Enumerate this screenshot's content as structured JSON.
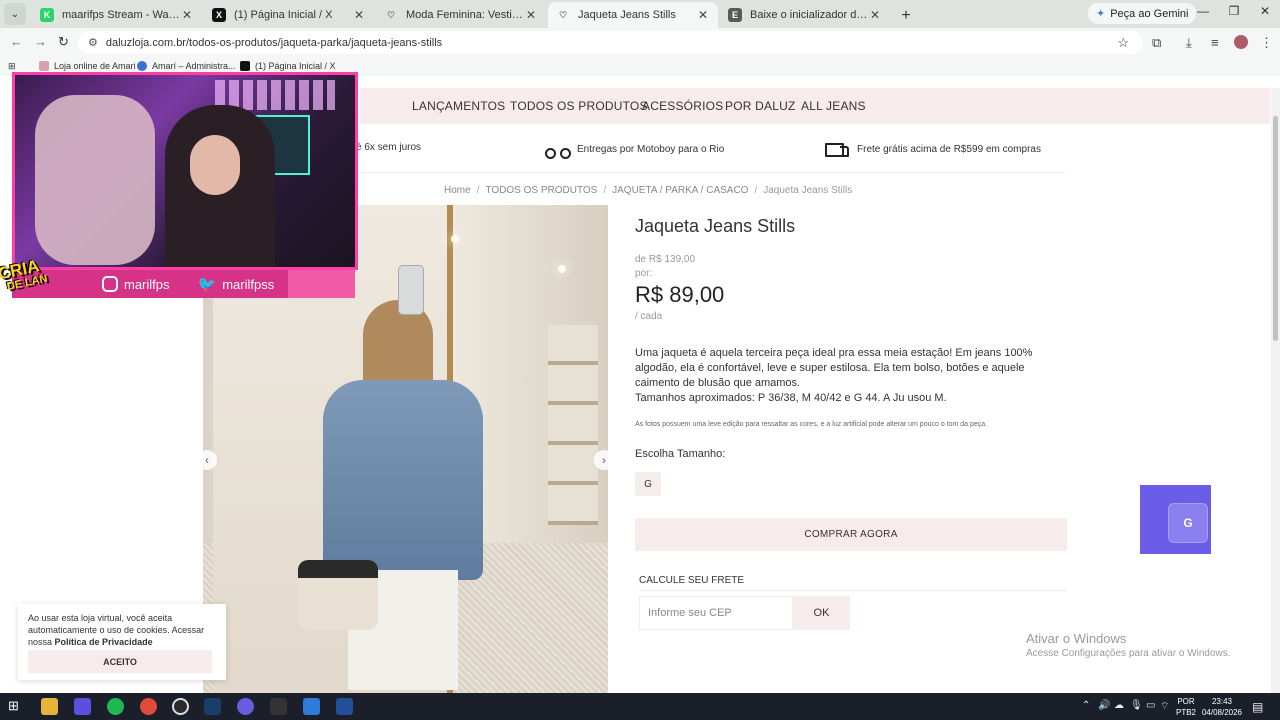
{
  "browser": {
    "tabs": [
      {
        "title": "maarifps Stream - Watch Live o",
        "color": "#2bd46a",
        "letter": "K"
      },
      {
        "title": "(1) Página Inicial / X",
        "color": "#111111",
        "letter": "X"
      },
      {
        "title": "Moda Feminina: Vestidos, Blusa",
        "color": "#c9c9c9",
        "letter": "♡"
      },
      {
        "title": "Jaqueta Jeans Stills",
        "color": "#c9c9c9",
        "letter": "♡"
      },
      {
        "title": "Baixe o inicializador da Epic Ga",
        "color": "#5a5a5a",
        "letter": "E"
      }
    ],
    "gemini_label": "Peça ao Gemini",
    "url": "daluzloja.com.br/todos-os-produtos/jaqueta-parka/jaqueta-jeans-stills",
    "bookmarks": [
      {
        "label": "Loja online de Amari",
        "color": "#d8a0b0"
      },
      {
        "label": "Amarí – Administra...",
        "color": "#3a6fd8"
      },
      {
        "label": "(1) Página Inicial / X",
        "color": "#111111"
      }
    ]
  },
  "site": {
    "nav": [
      "LANÇAMENTOS",
      "TODOS OS PRODUTOS",
      "ACESSÓRIOS",
      "POR DALUZ",
      "ALL JEANS"
    ],
    "benefits": {
      "installments": "é 6x sem juros",
      "motoboy": "Entregas por Motoboy para o Rio",
      "free_shipping": "Frete grátis acima de R$599 em compras"
    },
    "breadcrumb": [
      "Home",
      "TODOS OS PRODUTOS",
      "JAQUETA / PARKA / CASACO",
      "Jaqueta Jeans Stills"
    ],
    "breadcrumb_sep": "/",
    "carousel_prev": "‹",
    "carousel_next": "›"
  },
  "product": {
    "title": "Jaqueta Jeans Stills",
    "old_price": "de R$ 139,00",
    "por": "por:",
    "price": "R$ 89,00",
    "unit": "/ cada",
    "description_1": "Uma jaqueta é aquela terceira peça ideal pra essa meia estação! Em jeans 100% algodão, ela é confortável, leve e super estilosa. Ela tem bolso, botões e aquele caimento de blusão que amamos.",
    "description_2": "Tamanhos aproximados: P 36/38, M 40/42 e G 44. A Ju usou M.",
    "note": "As fotos possuem uma leve edição para ressaltar as cores, e a luz artificial pode alterar um pouco o tom da peça.",
    "size_label": "Escolha Tamanho:",
    "sizes": [
      "G"
    ],
    "buy_label": "COMPRAR AGORA",
    "shipping_label": "CALCULE SEU FRETE",
    "cep_placeholder": "Informe seu CEP",
    "ok_label": "OK"
  },
  "cookie": {
    "text": "Ao usar esta loja virtual, você aceita automaticamente o uso de cookies. Acessar nossa",
    "link": "Política de Privacidade",
    "button": "ACEITO"
  },
  "stream": {
    "instagram": "marilfps",
    "twitter": "marilfpss",
    "logo_main": "CRIA",
    "logo_sub": "DE LAN"
  },
  "windows": {
    "activate_title": "Ativar o Windows",
    "activate_sub": "Acesse Configurações para ativar o Windows.",
    "lang_1": "POR",
    "lang_2": "PTB2",
    "time": "23:43",
    "date": "04/08/2026"
  },
  "colors": {
    "accent_band": "#f7eceb",
    "stream_pink": "#d63287"
  }
}
